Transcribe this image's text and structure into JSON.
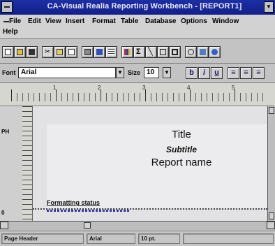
{
  "window": {
    "title": "CA-Visual Realia Reporting Workbench - [REPORT1]",
    "minimize_glyph": "▼"
  },
  "menu": {
    "items": [
      {
        "label": "File"
      },
      {
        "label": "Edit"
      },
      {
        "label": "View"
      },
      {
        "label": "Insert"
      },
      {
        "label": "Format"
      },
      {
        "label": "Table"
      },
      {
        "label": "Database"
      },
      {
        "label": "Options"
      },
      {
        "label": "Window"
      },
      {
        "label": "Help"
      }
    ]
  },
  "toolbar": {
    "icons": [
      "new-icon",
      "open-icon",
      "save-icon",
      "cut-icon",
      "copy-icon",
      "paste-icon",
      "print-icon",
      "print-preview-icon",
      "table-icon",
      "chart-icon",
      "sum-icon",
      "line-icon",
      "rectangle-icon",
      "field-icon",
      "zoom-icon",
      "picture-icon",
      "help-icon"
    ]
  },
  "font_bar": {
    "font_label": "Font",
    "font_value": "Arial",
    "size_label": "Size",
    "size_value": "10",
    "bold": "b",
    "italic": "i",
    "underline": "u"
  },
  "ruler": {
    "numbers": [
      "1",
      "2",
      "3",
      "4",
      "5"
    ]
  },
  "report": {
    "band_label_top": "PH",
    "band_label_bottom": "0",
    "title": "Title",
    "subtitle": "Subtitle",
    "report_name": "Report name",
    "formatting_status": "Formatting status"
  },
  "status_bar": {
    "section": "Page Header",
    "font": "Arial",
    "size": "10 pt."
  },
  "colors": {
    "titlebar": "#12208a",
    "accent_blue": "#2a35a8"
  }
}
